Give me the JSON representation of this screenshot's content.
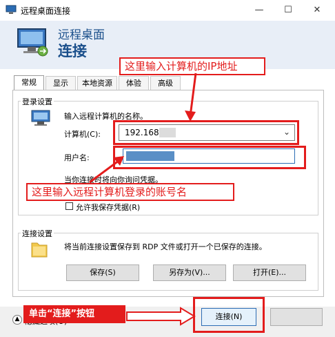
{
  "window": {
    "title": "远程桌面连接",
    "controls": {
      "minimize": "—",
      "maximize": "☐",
      "close": "✕"
    }
  },
  "header": {
    "line1": "远程桌面",
    "line2": "连接"
  },
  "tabs": [
    {
      "label": "常规",
      "active": true
    },
    {
      "label": "显示",
      "active": false
    },
    {
      "label": "本地资源",
      "active": false
    },
    {
      "label": "体验",
      "active": false
    },
    {
      "label": "高级",
      "active": false
    }
  ],
  "login": {
    "legend": "登录设置",
    "instruction": "输入远程计算机的名称。",
    "computer_label": "计算机(C):",
    "computer_value": "192.168.",
    "username_label": "用户名:",
    "prompt_text": "当你连接时将向你询问凭据。",
    "allow_save_label": "允许我保存凭据(R)"
  },
  "connection": {
    "legend": "连接设置",
    "description": "将当前连接设置保存到 RDP 文件或打开一个已保存的连接。",
    "save_label": "保存(S)",
    "save_as_label": "另存为(V)...",
    "open_label": "打开(E)..."
  },
  "footer": {
    "hide_options_label": "隐藏选项(O)",
    "connect_label": "连接(N)"
  },
  "annotations": {
    "ip_note": "这里输入计算机的IP地址",
    "user_note": "这里输入远程计算机登录的账号名",
    "connect_note": "单击“连接”按钮"
  },
  "colors": {
    "annotation": "#e31c1c",
    "header_text": "#1a4f8b",
    "header_bg": "#e8eef7"
  }
}
